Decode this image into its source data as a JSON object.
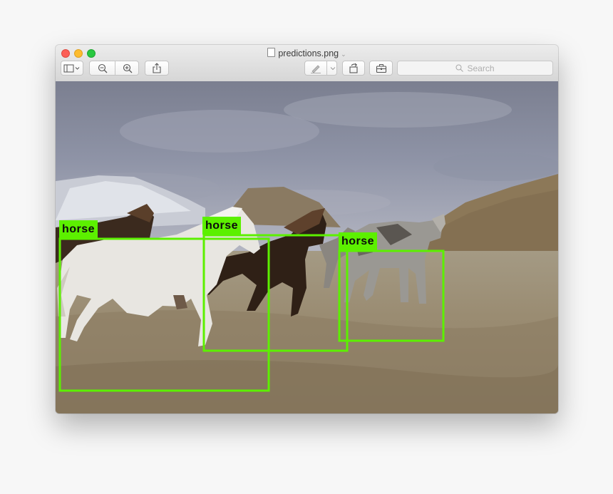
{
  "window": {
    "title": "predictions.png",
    "search_placeholder": "Search"
  },
  "toolbar": {
    "icons": [
      "sidebar-icon",
      "chevron-down-icon",
      "zoom-out-icon",
      "zoom-in-icon",
      "share-icon",
      "markup-pen-icon",
      "chevron-down-icon",
      "rotate-icon",
      "toolbox-icon",
      "search-icon"
    ]
  },
  "detections": [
    {
      "label": "horse"
    },
    {
      "label": "horse"
    },
    {
      "label": "horse"
    }
  ],
  "colors": {
    "box": "#5cf000",
    "close": "#fc5f57",
    "minimize": "#fdbc2e",
    "maximize": "#28c840"
  }
}
